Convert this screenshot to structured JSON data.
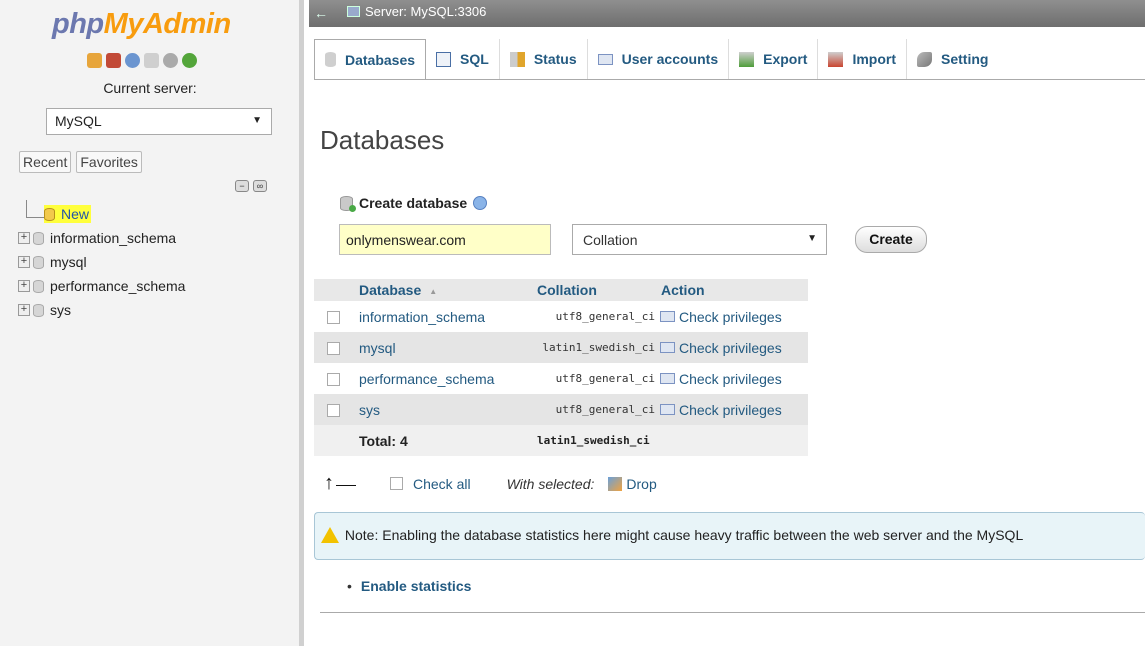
{
  "logo": {
    "php": "php",
    "myadmin": "MyAdmin"
  },
  "navigation": {
    "current_server_label": "Current server:",
    "server_value": "MySQL",
    "recent_label": "Recent",
    "favorites_label": "Favorites",
    "tree": [
      {
        "label": "New"
      },
      {
        "label": "information_schema"
      },
      {
        "label": "mysql"
      },
      {
        "label": "performance_schema"
      },
      {
        "label": "sys"
      }
    ]
  },
  "topbar": {
    "back_arrow": "←",
    "title": "Server: MySQL:3306"
  },
  "tabs": [
    {
      "label": "Databases",
      "icon": "database-icon",
      "active": true
    },
    {
      "label": "SQL",
      "icon": "sql-icon"
    },
    {
      "label": "Status",
      "icon": "status-chart-icon"
    },
    {
      "label": "User accounts",
      "icon": "users-icon"
    },
    {
      "label": "Export",
      "icon": "export-icon"
    },
    {
      "label": "Import",
      "icon": "import-icon"
    },
    {
      "label": "Setting",
      "icon": "wrench-icon"
    }
  ],
  "page_title": "Databases",
  "create_database": {
    "heading": "Create database",
    "name_value": "onlymenswear.com",
    "collation_value": "Collation",
    "create_button": "Create"
  },
  "table": {
    "headers": {
      "database": "Database",
      "collation": "Collation",
      "action": "Action"
    },
    "rows": [
      {
        "name": "information_schema",
        "collation": "utf8_general_ci",
        "action": "Check privileges"
      },
      {
        "name": "mysql",
        "collation": "latin1_swedish_ci",
        "action": "Check privileges"
      },
      {
        "name": "performance_schema",
        "collation": "utf8_general_ci",
        "action": "Check privileges"
      },
      {
        "name": "sys",
        "collation": "utf8_general_ci",
        "action": "Check privileges"
      }
    ],
    "footer": {
      "total": "Total: 4",
      "collation": "latin1_swedish_ci"
    }
  },
  "bulk": {
    "check_all": "Check all",
    "with_selected": "With selected:",
    "drop": "Drop"
  },
  "note": "Note: Enabling the database statistics here might cause heavy traffic between the web server and the MySQL",
  "enable_stats": "Enable statistics",
  "colors": {
    "link": "#235a81",
    "highlight": "#ffff3c",
    "input_highlight": "#ffffc8"
  }
}
